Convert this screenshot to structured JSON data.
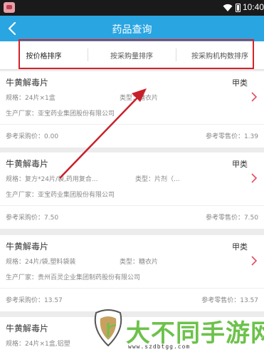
{
  "status_bar": {
    "time": "10:40"
  },
  "header": {
    "title": "药品查询",
    "back_icon": "chevron-left-icon"
  },
  "sort_tabs": [
    {
      "label": "按价格排序",
      "active": true
    },
    {
      "label": "按采购量排序",
      "active": false
    },
    {
      "label": "按采购机构数排序",
      "active": false
    }
  ],
  "drugs": [
    {
      "name": "牛黄解毒片",
      "category": "甲类",
      "spec_label": "规格：",
      "spec": "24片×1盒",
      "type_label": "类型：",
      "type": "糖衣片",
      "maker_label": "生产厂家：",
      "maker": "亚宝药业集团股份有限公司",
      "purchase_label": "参考采购价：",
      "purchase_price": "0.00",
      "retail_label": "参考零售价：",
      "retail_price": "1.39"
    },
    {
      "name": "牛黄解毒片",
      "category": "甲类",
      "spec_label": "规格：",
      "spec": "复方*24片/袋,药用复合...",
      "type_label": "类型：",
      "type": "片剂（...",
      "maker_label": "生产厂家：",
      "maker": "亚宝药业集团股份有限公司",
      "purchase_label": "参考采购价：",
      "purchase_price": "7.50",
      "retail_label": "参考零售价：",
      "retail_price": "7.50"
    },
    {
      "name": "牛黄解毒片",
      "category": "甲类",
      "spec_label": "规格：",
      "spec": "24片/袋,塑料袋装",
      "type_label": "类型：",
      "type": "糖衣片",
      "maker_label": "生产厂家：",
      "maker": "贵州百灵企业集团制药股份有限公司",
      "purchase_label": "参考采购价：",
      "purchase_price": "13.57",
      "retail_label": "参考零售价：",
      "retail_price": "13.57"
    },
    {
      "name": "牛黄解毒片",
      "spec_label": "规格：",
      "spec": "24片×1盒,铝塑"
    }
  ],
  "colors": {
    "header": "#29a5e2",
    "chevron": "#e84a5f",
    "highlight": "#d2232a",
    "watermark": "#6cc24a"
  },
  "watermark": {
    "text": "大不同手游网",
    "url": "www.szdbtgg.com"
  }
}
